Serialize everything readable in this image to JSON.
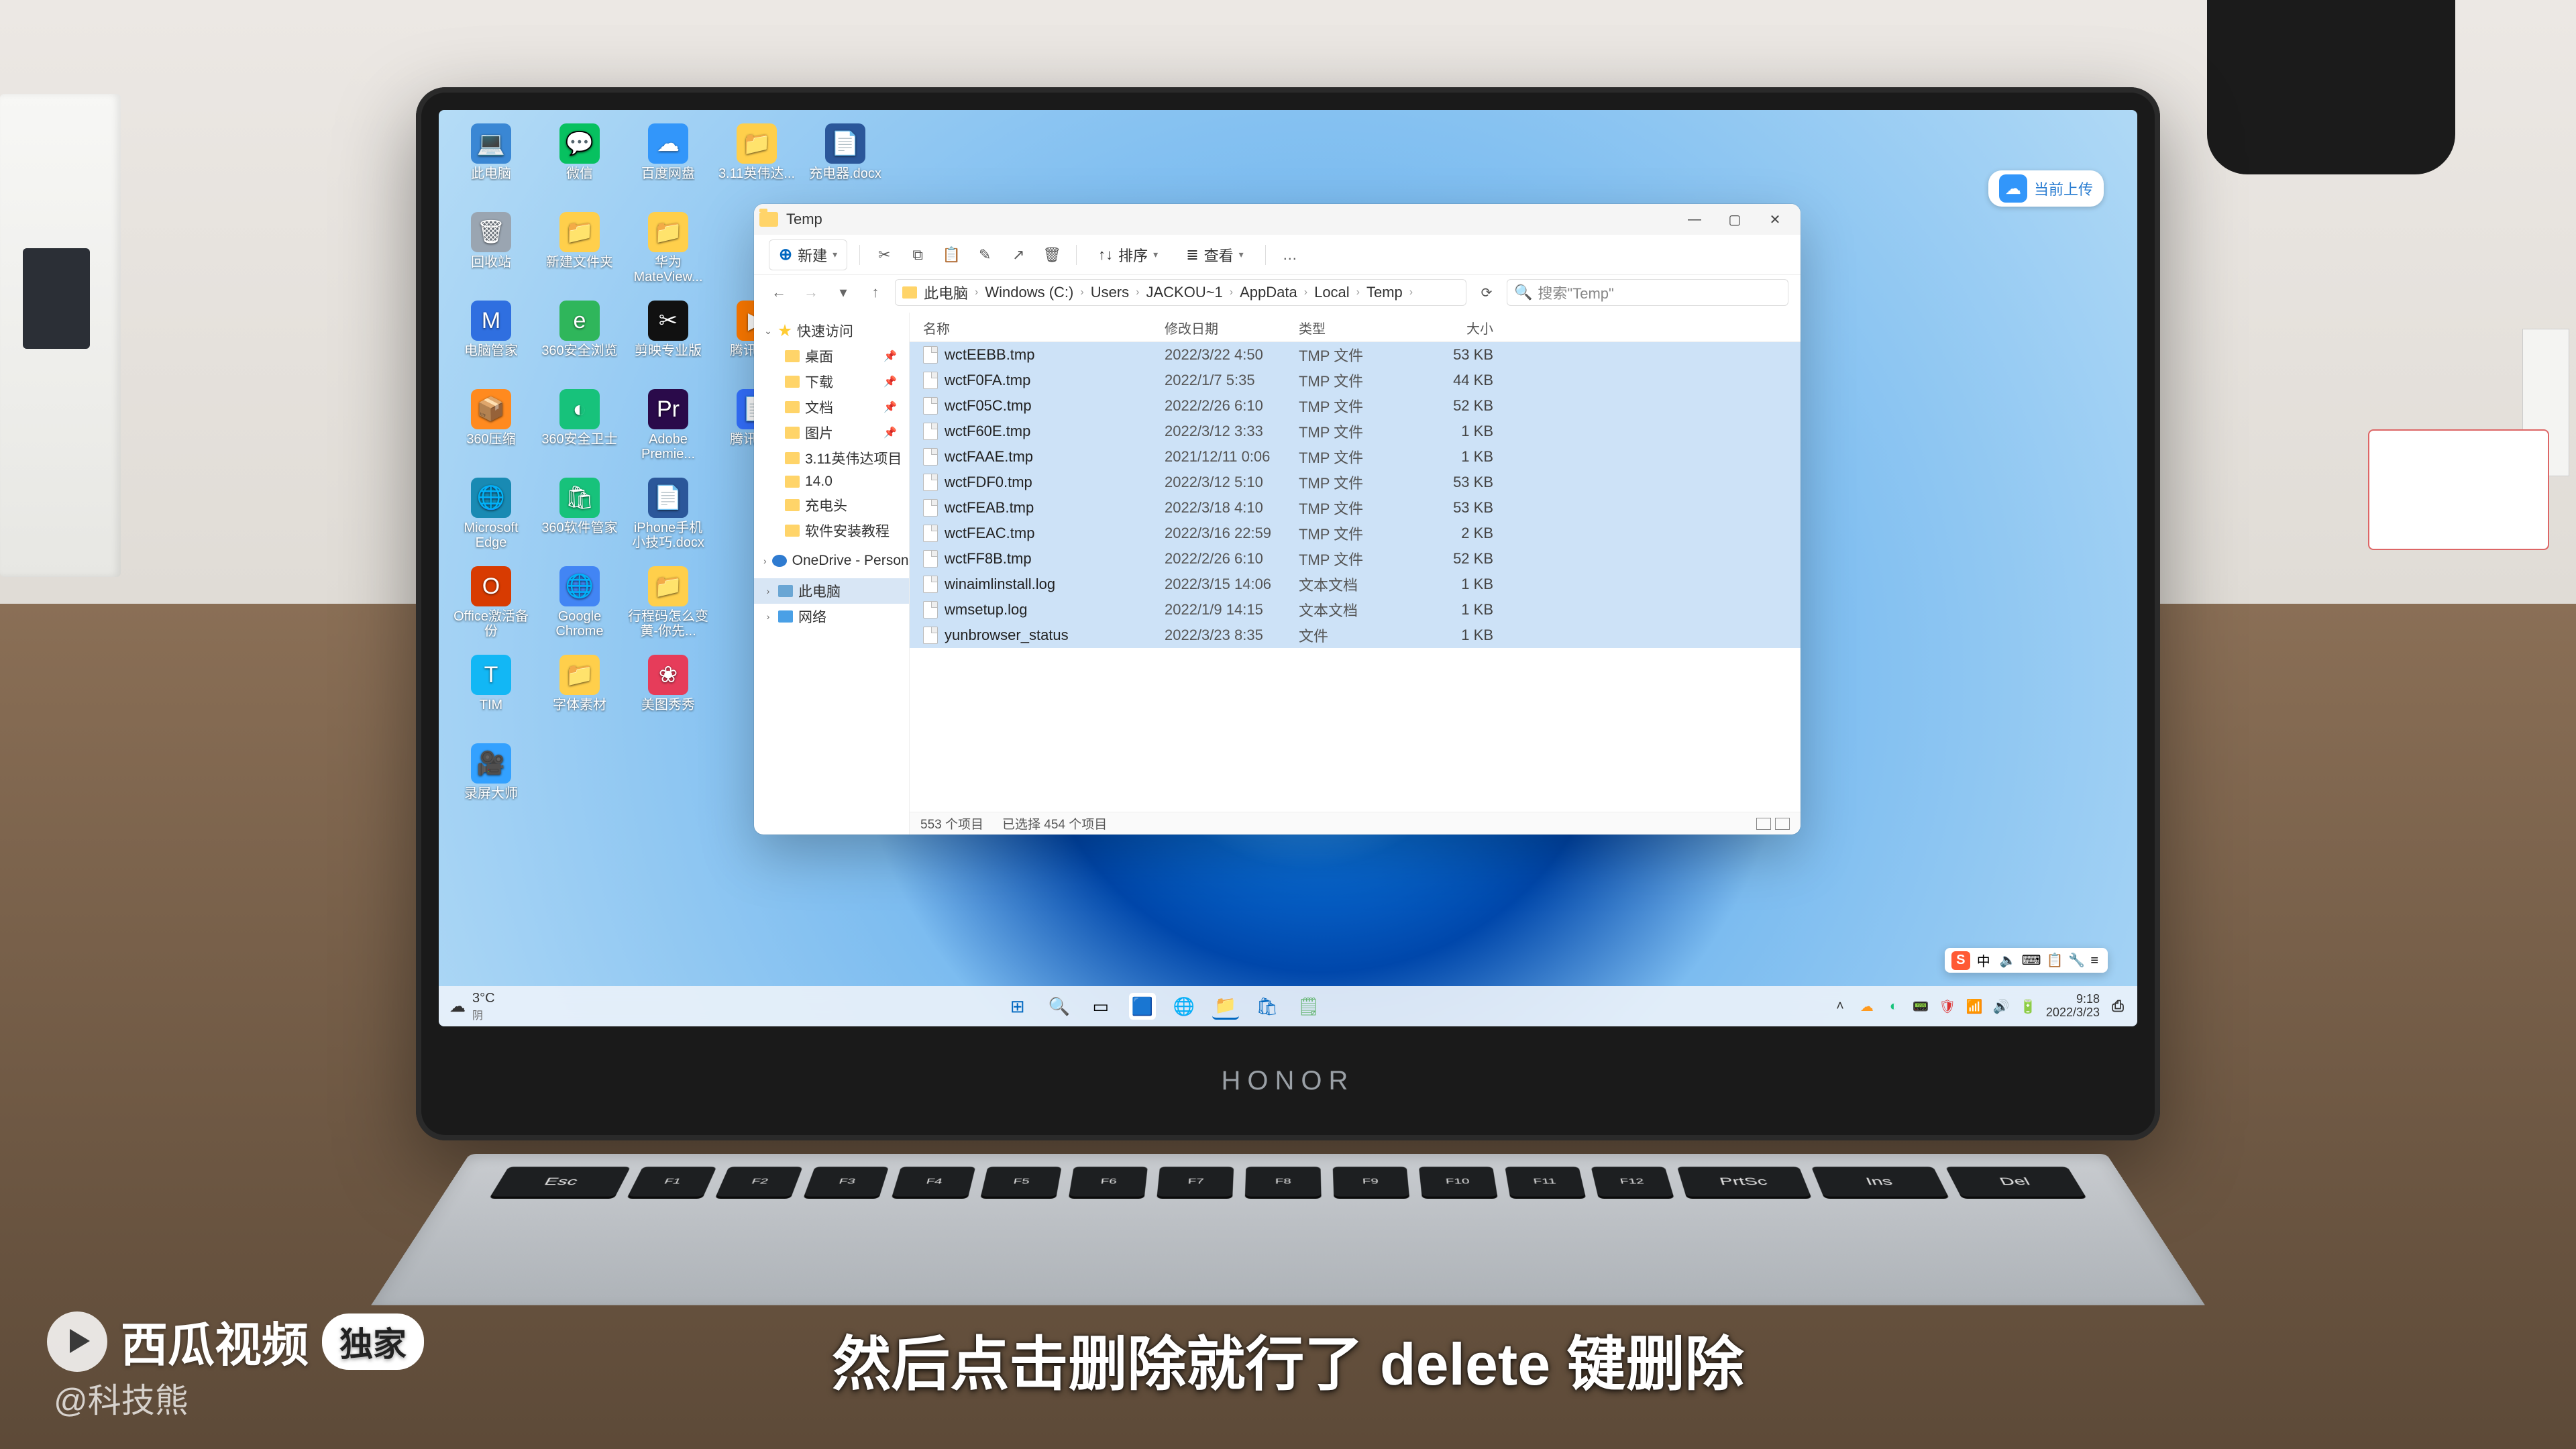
{
  "window": {
    "title": "Temp",
    "buttons": {
      "min": "—",
      "max": "▢",
      "close": "✕"
    }
  },
  "toolbar": {
    "new": "新建",
    "cut": "剪切",
    "copy": "复制",
    "paste": "粘贴",
    "rename": "重命名",
    "share": "分享",
    "delete": "删除",
    "sort": "排序",
    "view": "查看",
    "more": "…"
  },
  "address": {
    "back": "←",
    "forward": "→",
    "up": "↑",
    "refresh": "⟳",
    "crumbs": [
      "此电脑",
      "Windows (C:)",
      "Users",
      "JACKOU~1",
      "AppData",
      "Local",
      "Temp"
    ],
    "search_placeholder": "搜索\"Temp\""
  },
  "sidebar": {
    "quick": "快速访问",
    "items": [
      {
        "label": "桌面",
        "pinned": true
      },
      {
        "label": "下载",
        "pinned": true
      },
      {
        "label": "文档",
        "pinned": true
      },
      {
        "label": "图片",
        "pinned": true
      },
      {
        "label": "3.11英伟达项目",
        "pinned": false
      },
      {
        "label": "14.0",
        "pinned": false
      },
      {
        "label": "充电头",
        "pinned": false
      },
      {
        "label": "软件安装教程",
        "pinned": false
      }
    ],
    "onedrive": "OneDrive - Persona",
    "thispc": "此电脑",
    "network": "网络"
  },
  "columns": {
    "name": "名称",
    "date": "修改日期",
    "type": "类型",
    "size": "大小"
  },
  "files": [
    {
      "name": "wctEEBB.tmp",
      "date": "2022/3/22 4:50",
      "type": "TMP 文件",
      "size": "53 KB",
      "sel": true
    },
    {
      "name": "wctF0FA.tmp",
      "date": "2022/1/7 5:35",
      "type": "TMP 文件",
      "size": "44 KB",
      "sel": true
    },
    {
      "name": "wctF05C.tmp",
      "date": "2022/2/26 6:10",
      "type": "TMP 文件",
      "size": "52 KB",
      "sel": true
    },
    {
      "name": "wctF60E.tmp",
      "date": "2022/3/12 3:33",
      "type": "TMP 文件",
      "size": "1 KB",
      "sel": true
    },
    {
      "name": "wctFAAE.tmp",
      "date": "2021/12/11 0:06",
      "type": "TMP 文件",
      "size": "1 KB",
      "sel": true
    },
    {
      "name": "wctFDF0.tmp",
      "date": "2022/3/12 5:10",
      "type": "TMP 文件",
      "size": "53 KB",
      "sel": true
    },
    {
      "name": "wctFEAB.tmp",
      "date": "2022/3/18 4:10",
      "type": "TMP 文件",
      "size": "53 KB",
      "sel": true
    },
    {
      "name": "wctFEAC.tmp",
      "date": "2022/3/16 22:59",
      "type": "TMP 文件",
      "size": "2 KB",
      "sel": true
    },
    {
      "name": "wctFF8B.tmp",
      "date": "2022/2/26 6:10",
      "type": "TMP 文件",
      "size": "52 KB",
      "sel": true
    },
    {
      "name": "winaimlinstall.log",
      "date": "2022/3/15 14:06",
      "type": "文本文档",
      "size": "1 KB",
      "sel": true
    },
    {
      "name": "wmsetup.log",
      "date": "2022/1/9 14:15",
      "type": "文本文档",
      "size": "1 KB",
      "sel": true
    },
    {
      "name": "yunbrowser_status",
      "date": "2022/3/23 8:35",
      "type": "文件",
      "size": "1 KB",
      "sel": true
    }
  ],
  "status": {
    "total": "553 个项目",
    "selected": "已选择 454 个项目"
  },
  "desktop_icons": [
    [
      "此电脑",
      "💻",
      "#3a87d4"
    ],
    [
      "微信",
      "💬",
      "#07c160"
    ],
    [
      "百度网盘",
      "☁",
      "#3296fa"
    ],
    [
      "3.11英伟达...",
      "📁",
      "#ffcf4b"
    ],
    [
      "充电器.docx",
      "📄",
      "#2b579a"
    ],
    [
      "回收站",
      "🗑",
      "#9aa5b1"
    ],
    [
      "新建文件夹",
      "📁",
      "#ffcf4b"
    ],
    [
      "华为MateView...",
      "📁",
      "#ffcf4b"
    ],
    [
      "",
      ""
    ],
    [
      "",
      ""
    ],
    [
      "电脑管家",
      "M",
      "#2f6fe0"
    ],
    [
      "360安全浏览",
      "e",
      "#2fb65b"
    ],
    [
      "剪映专业版",
      "✂",
      "#111"
    ],
    [
      "腾讯视频",
      "▶",
      "#ff7a00"
    ],
    [
      "",
      ""
    ],
    [
      "360压缩",
      "📦",
      "#ff8a1f"
    ],
    [
      "360安全卫士",
      "◐",
      "#17c27b"
    ],
    [
      "Adobe Premie...",
      "Pr",
      "#2a0a4a"
    ],
    [
      "腾讯文档",
      "📄",
      "#3370ff"
    ],
    [
      "",
      ""
    ],
    [
      "Microsoft Edge",
      "🌐",
      "#198ab3"
    ],
    [
      "360软件管家",
      "🛍",
      "#17c27b"
    ],
    [
      "iPhone手机小技巧.docx",
      "📄",
      "#2b579a"
    ],
    [
      "",
      ""
    ],
    [
      "",
      ""
    ],
    [
      "Office激活备份",
      "O",
      "#d83b01"
    ],
    [
      "Google Chrome",
      "🌐",
      "#4285f4"
    ],
    [
      "行程码怎么变黄-你先...",
      "📁",
      "#ffcf4b"
    ],
    [
      "",
      ""
    ],
    [
      "",
      ""
    ],
    [
      "TIM",
      "T",
      "#12b7f5"
    ],
    [
      "字体素材",
      "📁",
      "#ffcf4b"
    ],
    [
      "美图秀秀",
      "❀",
      "#e63c5a"
    ],
    [
      "",
      ""
    ],
    [
      "",
      ""
    ],
    [
      "录屏大师",
      "🎥",
      "#33a1ff"
    ],
    [
      "",
      ""
    ],
    [
      "",
      ""
    ],
    [
      "",
      ""
    ],
    [
      "",
      ""
    ]
  ],
  "cloud_badge": "当前上传",
  "taskbar": {
    "weather": {
      "temp": "3°C",
      "cond": "阴"
    },
    "time": "9:18",
    "date": "2022/3/23"
  },
  "ime": {
    "brand": "S",
    "lang": "中",
    "items": [
      "🔈",
      "⌨",
      "📋",
      "🔧",
      "≡"
    ]
  },
  "caption": "然后点击删除就行了 delete 键删除",
  "watermark": {
    "brand": "西瓜视频",
    "tag": "独家",
    "handle": "@科技熊"
  },
  "laptop_brand": "HONOR",
  "keys_row": [
    "Esc",
    "F1",
    "F2",
    "F3",
    "F4",
    "F5",
    "F6",
    "F7",
    "F8",
    "F9",
    "F10",
    "F11",
    "F12",
    "PrtSc",
    "Ins",
    "Del"
  ]
}
